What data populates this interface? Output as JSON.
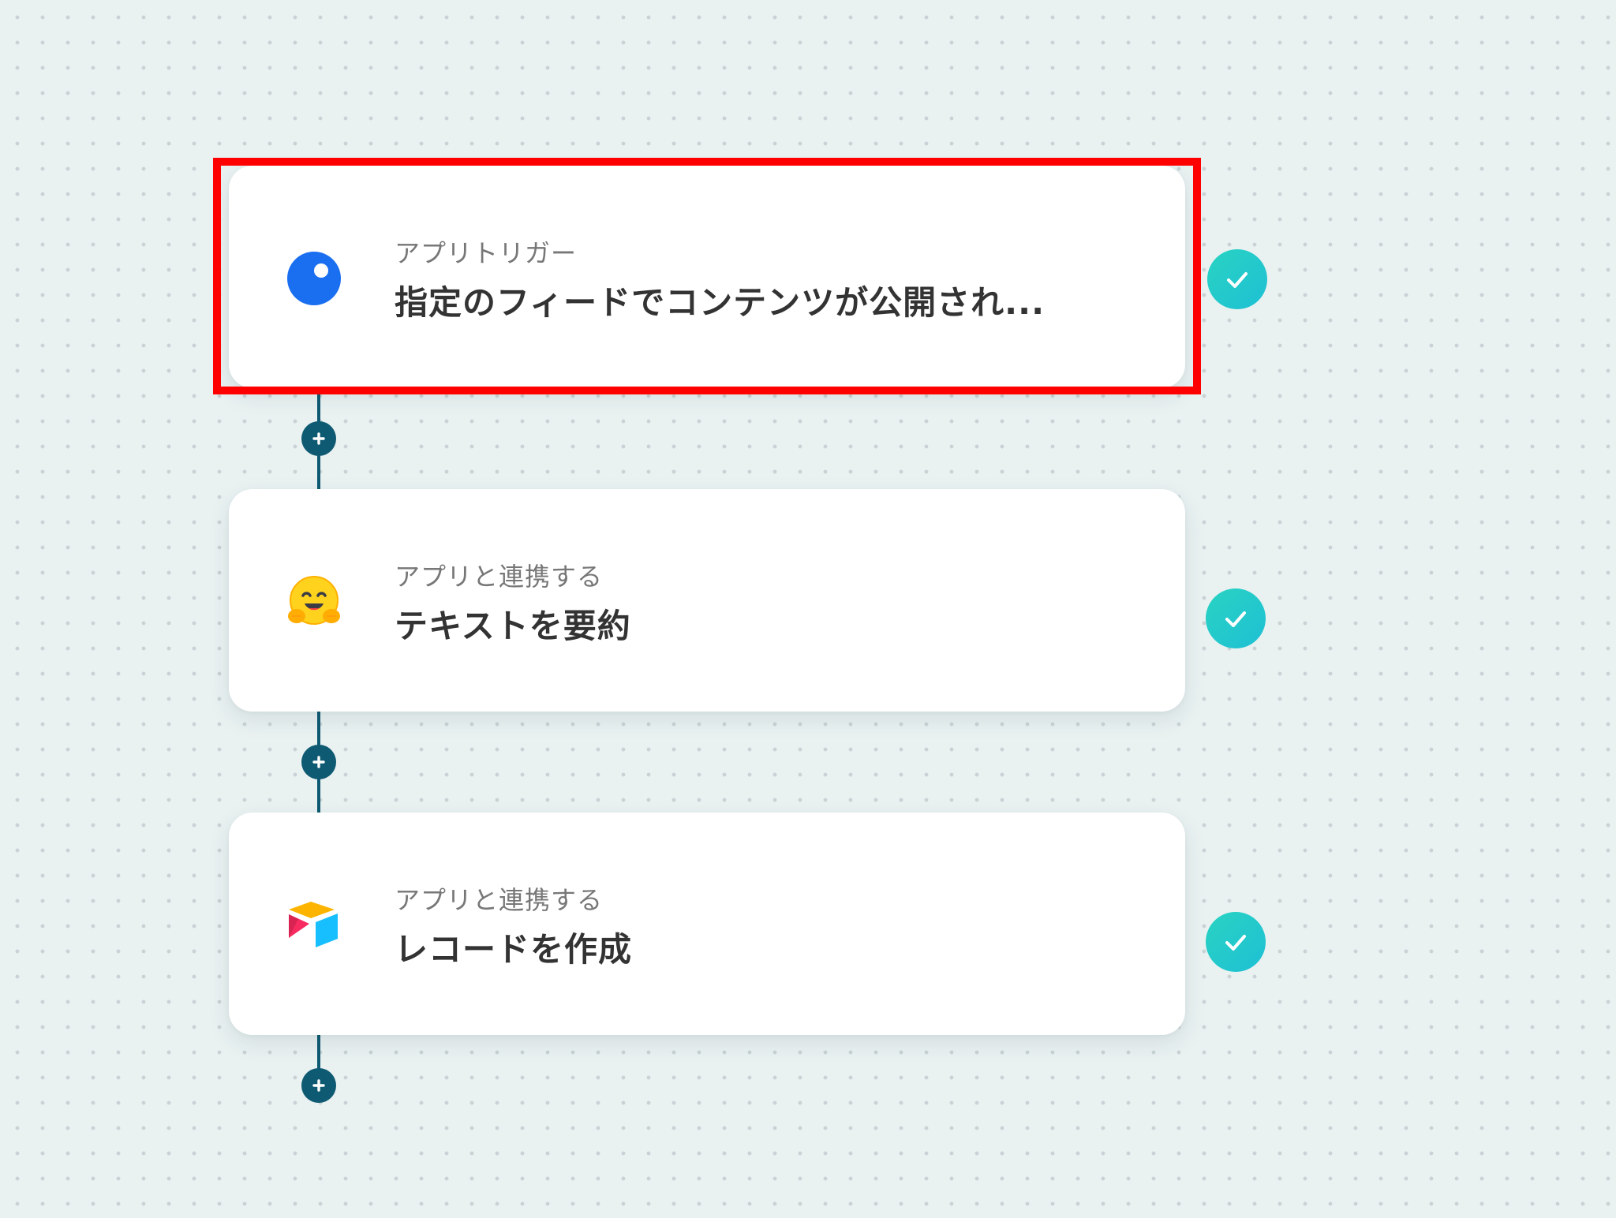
{
  "workflow": {
    "steps": [
      {
        "app_icon": "feed-icon",
        "label": "アプリトリガー",
        "title": "指定のフィードでコンテンツが公開され...",
        "status": "completed",
        "highlighted": true
      },
      {
        "app_icon": "hugging-face-icon",
        "label": "アプリと連携する",
        "title": "テキストを要約",
        "status": "completed",
        "highlighted": false
      },
      {
        "app_icon": "airtable-icon",
        "label": "アプリと連携する",
        "title": "レコードを作成",
        "status": "completed",
        "highlighted": false
      }
    ],
    "add_step_buttons": 3
  },
  "colors": {
    "background": "#e9f1f1",
    "connector": "#0e5a72",
    "check": "#29d3c2",
    "highlight": "#ff0000",
    "feed_blue": "#1a73e8"
  }
}
